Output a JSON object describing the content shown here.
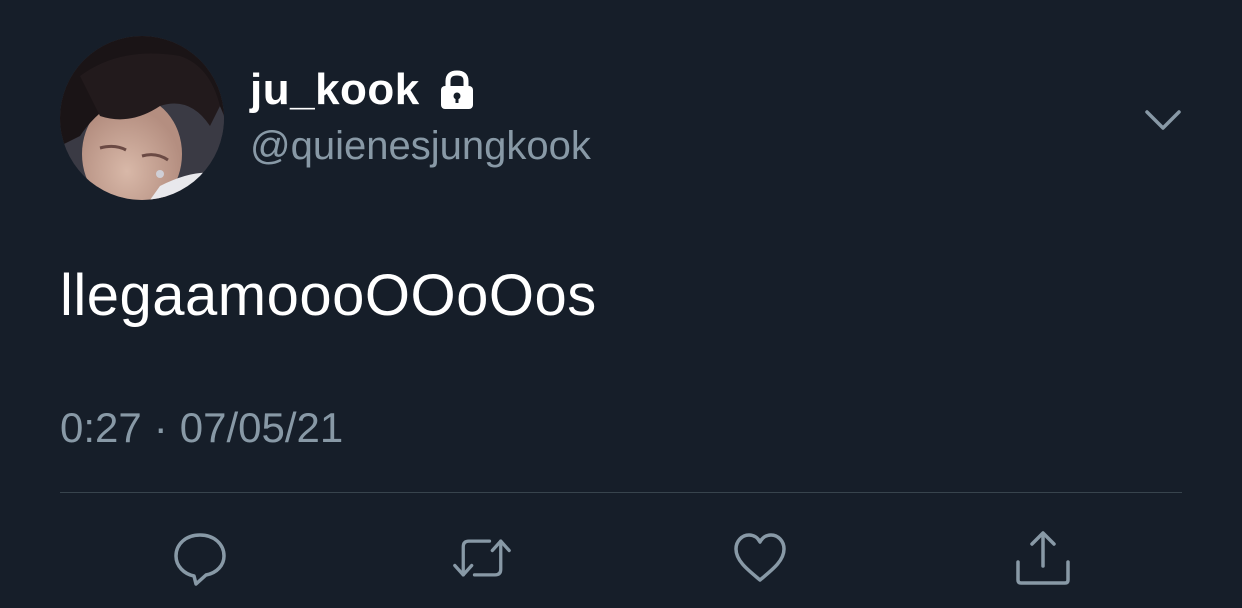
{
  "user": {
    "display_name": "ju_kook",
    "handle": "@quienesjungkook",
    "protected_icon": "lock-icon",
    "avatar_icon": "avatar"
  },
  "tweet": {
    "text": "llegaamoooOOoOos",
    "time": "0:27",
    "separator": "·",
    "date": "07/05/21"
  },
  "actions": [
    {
      "name": "reply",
      "icon": "speech-bubble-icon"
    },
    {
      "name": "retweet",
      "icon": "retweet-icon"
    },
    {
      "name": "like",
      "icon": "heart-icon"
    },
    {
      "name": "share",
      "icon": "share-icon"
    }
  ],
  "menu": {
    "icon": "chevron-down-icon"
  },
  "colors": {
    "background": "#161e29",
    "primary_text": "#ffffff",
    "secondary_text": "#8899a6",
    "divider": "#38444d"
  }
}
